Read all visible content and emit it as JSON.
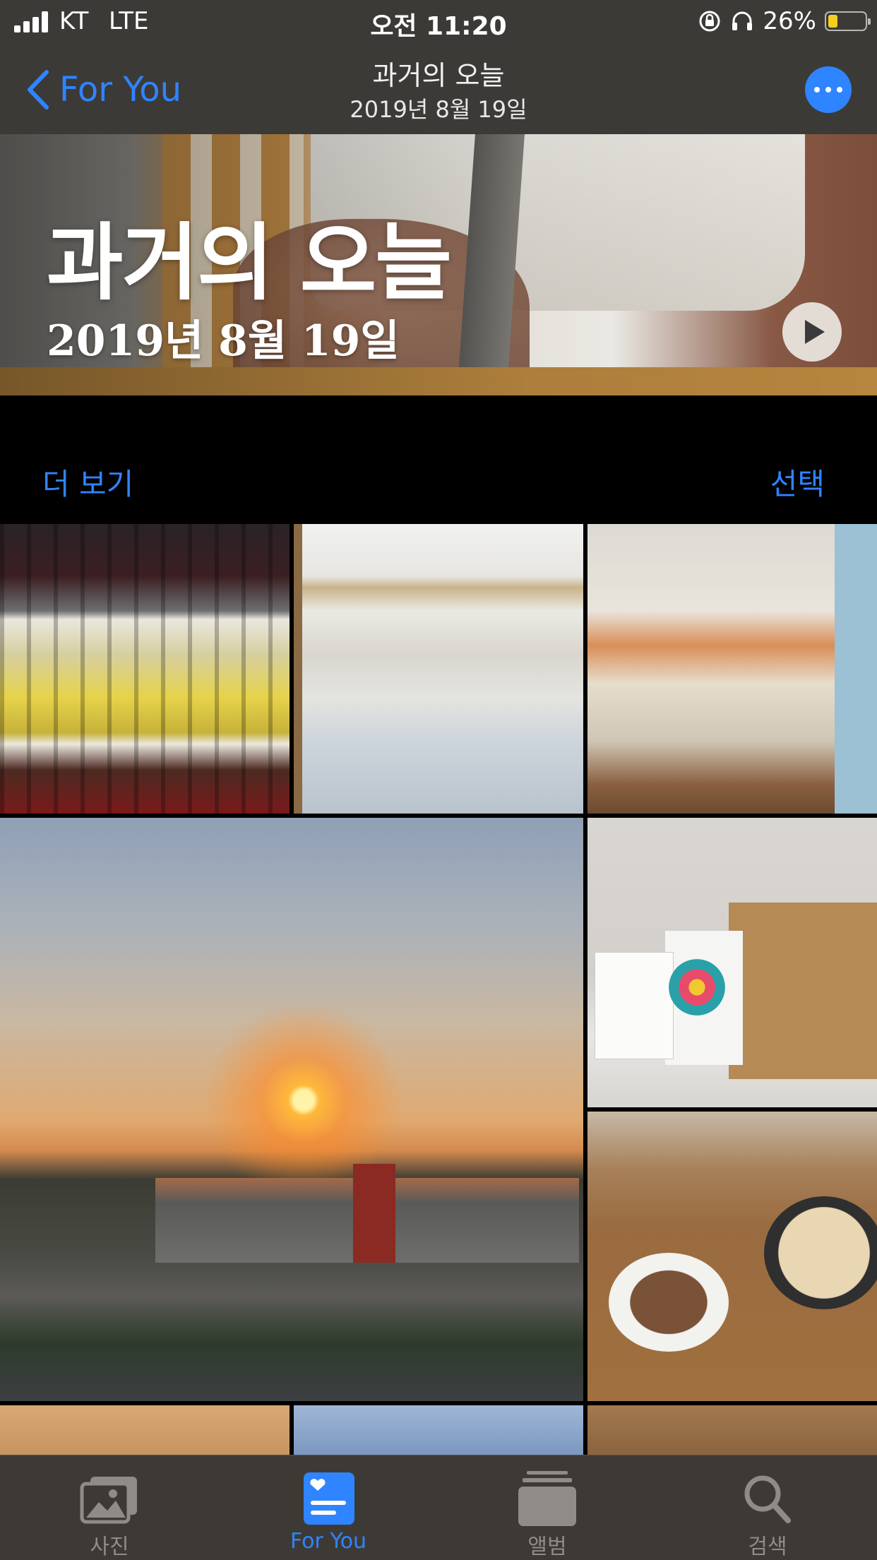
{
  "status_bar": {
    "carrier": "KT",
    "network": "LTE",
    "time": "오전 11:20",
    "battery_percent": "26%",
    "battery_level": 0.26,
    "battery_color": "#f5cf1e"
  },
  "nav": {
    "back_label": "For You",
    "title": "과거의 오늘",
    "subtitle": "2019년 8월 19일",
    "accent_color": "#2f84ff"
  },
  "hero": {
    "title": "과거의 오늘",
    "date": "2019년 8월 19일",
    "play_icon": "play-icon"
  },
  "section": {
    "see_more_label": "더 보기",
    "select_label": "선택"
  },
  "photos": [
    {
      "subject": "liquor-shelves"
    },
    {
      "subject": "open-refrigerator"
    },
    {
      "subject": "kitchen-room"
    },
    {
      "subject": "sunset-landscape"
    },
    {
      "subject": "shopping-bags"
    },
    {
      "subject": "table-with-food"
    },
    {
      "subject": "wood-surface"
    },
    {
      "subject": "blue-sky"
    },
    {
      "subject": "dining-table"
    }
  ],
  "tabbar": {
    "tabs": [
      {
        "label": "사진",
        "icon": "photos-icon",
        "active": false
      },
      {
        "label": "For You",
        "icon": "for-you-icon",
        "active": true
      },
      {
        "label": "앨범",
        "icon": "albums-icon",
        "active": false
      },
      {
        "label": "검색",
        "icon": "search-icon",
        "active": false
      }
    ]
  }
}
